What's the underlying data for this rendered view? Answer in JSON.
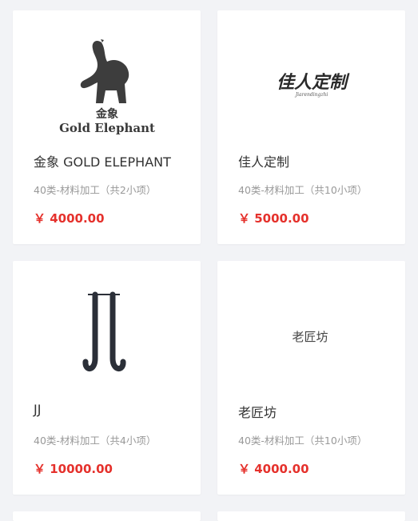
{
  "products": [
    {
      "name": "金象 GOLD ELEPHANT",
      "category": "40类-材料加工",
      "items": "（共2小项）",
      "price": "￥ 4000.00",
      "logo": {
        "icon": "elephant-logo-icon",
        "cn": "金象",
        "en": "Gold Elephant"
      }
    },
    {
      "name": "佳人定制",
      "category": "40类-材料加工",
      "items": "（共10小项）",
      "price": "￥ 5000.00",
      "logo": {
        "cn": "佳人定制",
        "sub": "Jiarendingzhi"
      }
    },
    {
      "name": "JJ",
      "category": "40类-材料加工",
      "items": "（共4小项）",
      "price": "￥ 10000.00",
      "logo": {
        "icon": "jj-monogram-icon"
      }
    },
    {
      "name": "老匠坊",
      "category": "40类-材料加工",
      "items": "（共10小项）",
      "price": "￥ 4000.00",
      "logo": {
        "cn": "老匠坊"
      }
    }
  ],
  "colors": {
    "price": "#e5312c",
    "background": "#f2f3f6",
    "card": "#ffffff"
  }
}
